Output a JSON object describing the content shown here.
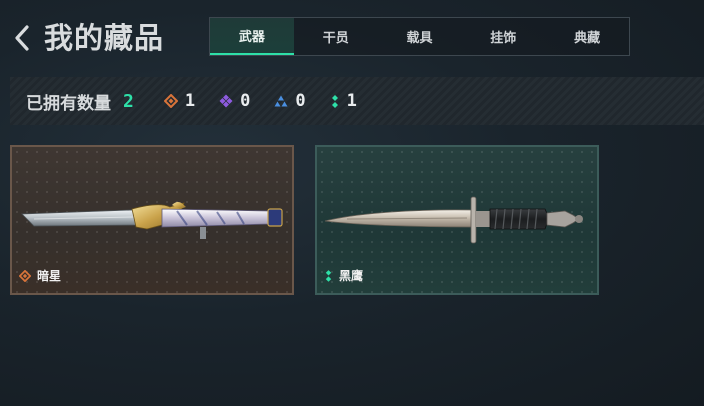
{
  "header": {
    "title": "我的藏品"
  },
  "tabs": [
    {
      "label": "武器",
      "active": true
    },
    {
      "label": "干员",
      "active": false
    },
    {
      "label": "载具",
      "active": false
    },
    {
      "label": "挂饰",
      "active": false
    },
    {
      "label": "典藏",
      "active": false
    }
  ],
  "stats": {
    "label": "已拥有数量",
    "total": "2",
    "rarities": [
      {
        "icon": "orange-diamond-icon",
        "color": "#d9743a",
        "count": "1"
      },
      {
        "icon": "purple-diamond-icon",
        "color": "#8d5be0",
        "count": "0"
      },
      {
        "icon": "blue-triangle-icon",
        "color": "#4a8fe0",
        "count": "0"
      },
      {
        "icon": "green-dots-icon",
        "color": "#2ee0a8",
        "count": "1"
      }
    ]
  },
  "items": [
    {
      "name": "暗星",
      "rarity_icon": "orange-diamond-icon",
      "rarity_color": "#d9743a",
      "weapon": "ornate-knife"
    },
    {
      "name": "黑鹰",
      "rarity_icon": "green-dots-icon",
      "rarity_color": "#2ee0a8",
      "weapon": "combat-knife"
    }
  ]
}
